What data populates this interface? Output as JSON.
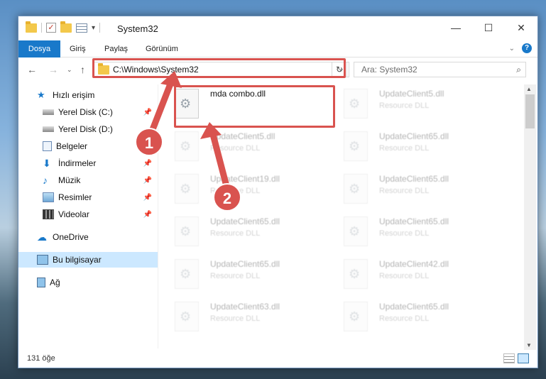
{
  "window": {
    "title": "System32",
    "controls": {
      "minimize": "—",
      "maximize": "☐",
      "close": "✕"
    }
  },
  "ribbon": {
    "tabs": [
      "Dosya",
      "Giriş",
      "Paylaş",
      "Görünüm"
    ]
  },
  "nav": {
    "address": "C:\\Windows\\System32",
    "search_placeholder": "Ara: System32"
  },
  "sidebar": {
    "items": [
      {
        "label": "Hızlı erişim",
        "icon": "star-icon",
        "pinned": false
      },
      {
        "label": "Yerel Disk (C:)",
        "icon": "drive-icon",
        "pinned": true
      },
      {
        "label": "Yerel Disk (D:)",
        "icon": "drive-icon",
        "pinned": false
      },
      {
        "label": "Belgeler",
        "icon": "documents-icon",
        "pinned": false
      },
      {
        "label": "İndirmeler",
        "icon": "download-icon",
        "pinned": true
      },
      {
        "label": "Müzik",
        "icon": "music-icon",
        "pinned": true
      },
      {
        "label": "Resimler",
        "icon": "pictures-icon",
        "pinned": true
      },
      {
        "label": "Videolar",
        "icon": "videos-icon",
        "pinned": true
      },
      {
        "label": "OneDrive",
        "icon": "cloud-icon",
        "pinned": false
      },
      {
        "label": "Bu bilgisayar",
        "icon": "computer-icon",
        "pinned": false
      },
      {
        "label": "Ağ",
        "icon": "network-icon",
        "pinned": false
      }
    ],
    "selected": "Bu bilgisayar"
  },
  "files": [
    {
      "name": "mda combo.dll",
      "type": ""
    },
    {
      "name": "UpdateClient5.dll",
      "type": "Resource DLL"
    },
    {
      "name": "UpdateClient5.dll",
      "type": "Resource DLL"
    },
    {
      "name": "UpdateClient65.dll",
      "type": "Resource DLL"
    },
    {
      "name": "UpdateClient19.dll",
      "type": "Resource DLL"
    },
    {
      "name": "UpdateClient65.dll",
      "type": "Resource DLL"
    },
    {
      "name": "UpdateClient65.dll",
      "type": "Resource DLL"
    },
    {
      "name": "UpdateClient65.dll",
      "type": "Resource DLL"
    },
    {
      "name": "UpdateClient65.dll",
      "type": "Resource DLL"
    },
    {
      "name": "UpdateClient42.dll",
      "type": "Resource DLL"
    },
    {
      "name": "UpdateClient63.dll",
      "type": "Resource DLL"
    },
    {
      "name": "UpdateClient65.dll",
      "type": "Resource DLL"
    }
  ],
  "status": {
    "item_count": "131 öğe"
  },
  "callouts": [
    "1",
    "2"
  ],
  "colors": {
    "accent": "#1979ca",
    "highlight": "#d9534f",
    "selected": "#cce8ff"
  }
}
